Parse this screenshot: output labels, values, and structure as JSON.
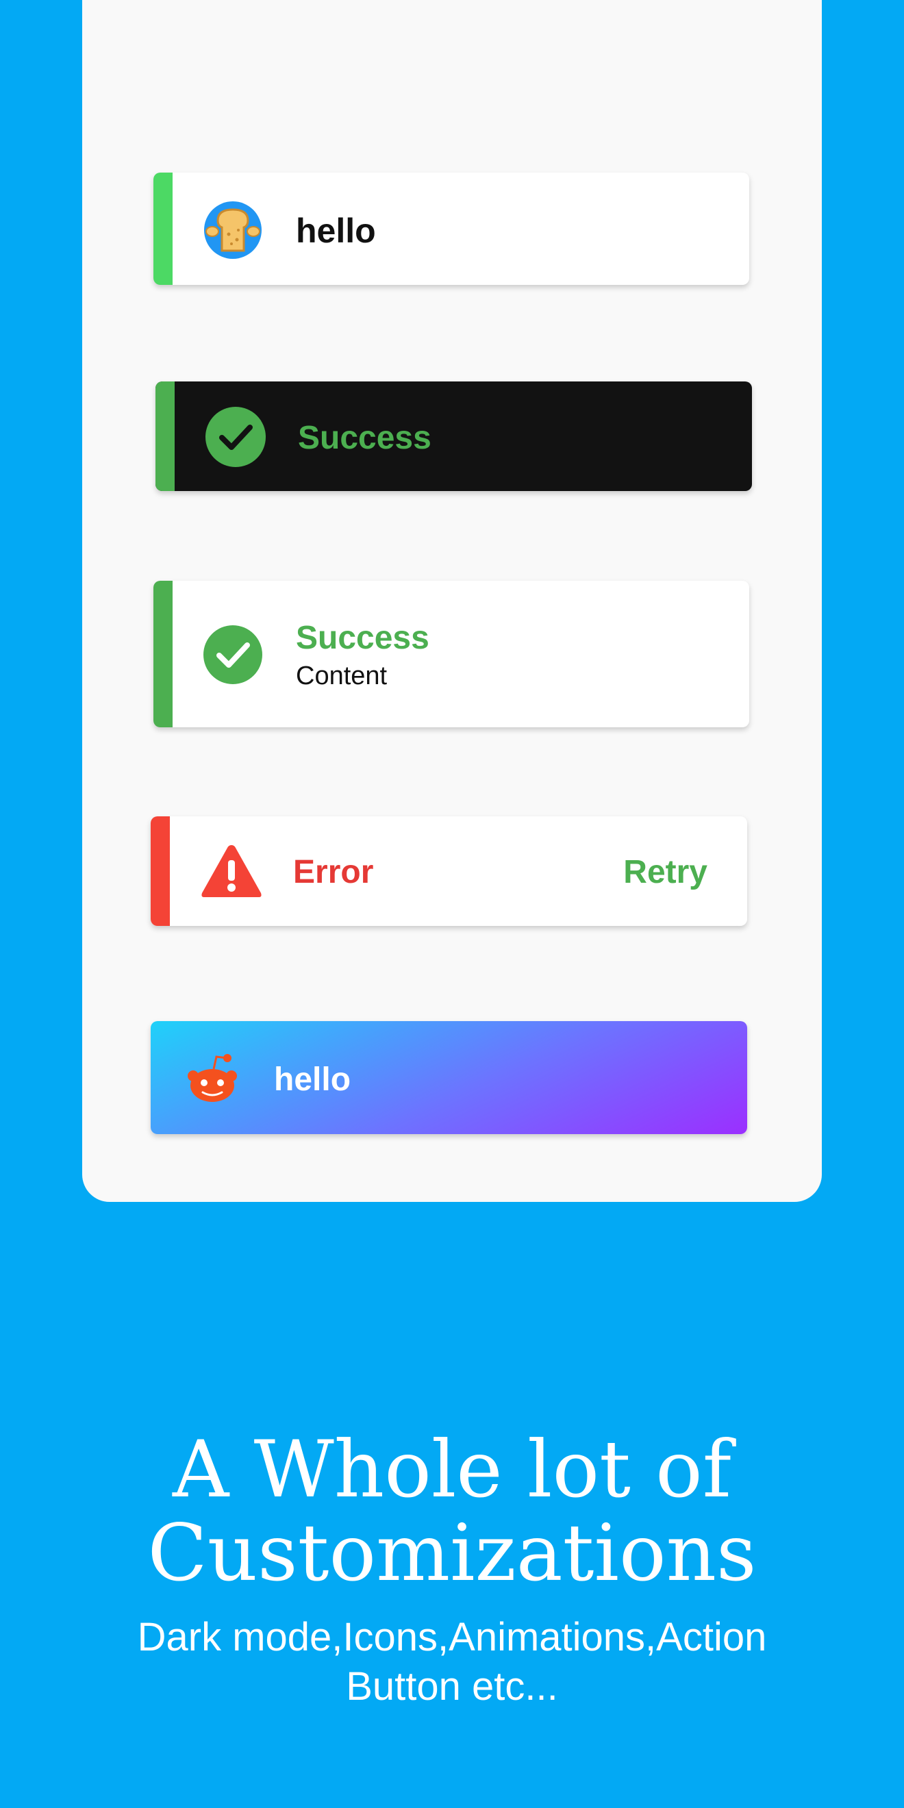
{
  "colors": {
    "background": "#03A9F4",
    "card": "#F9F9F9",
    "success": "#4CAF50",
    "error": "#F44336",
    "dark_toast": "#121212",
    "gradient": [
      "#1FD1F9",
      "#6C74FF",
      "#9B2FFF"
    ]
  },
  "toasts": [
    {
      "title": "hello",
      "icon": "toast-mascot-icon",
      "style": "light"
    },
    {
      "title": "Success",
      "icon": "check-circle-icon",
      "style": "dark"
    },
    {
      "title": "Success",
      "content": "Content",
      "icon": "check-circle-icon",
      "style": "light"
    },
    {
      "title": "Error",
      "action": "Retry",
      "icon": "warning-triangle-icon",
      "style": "light"
    },
    {
      "title": "hello",
      "icon": "reddit-alien-icon",
      "style": "gradient"
    }
  ],
  "headline": {
    "line1": "A Whole lot of",
    "line2": "Customizations"
  },
  "subline": {
    "line1": "Dark mode,Icons,Animations,Action",
    "line2": "Button etc..."
  }
}
